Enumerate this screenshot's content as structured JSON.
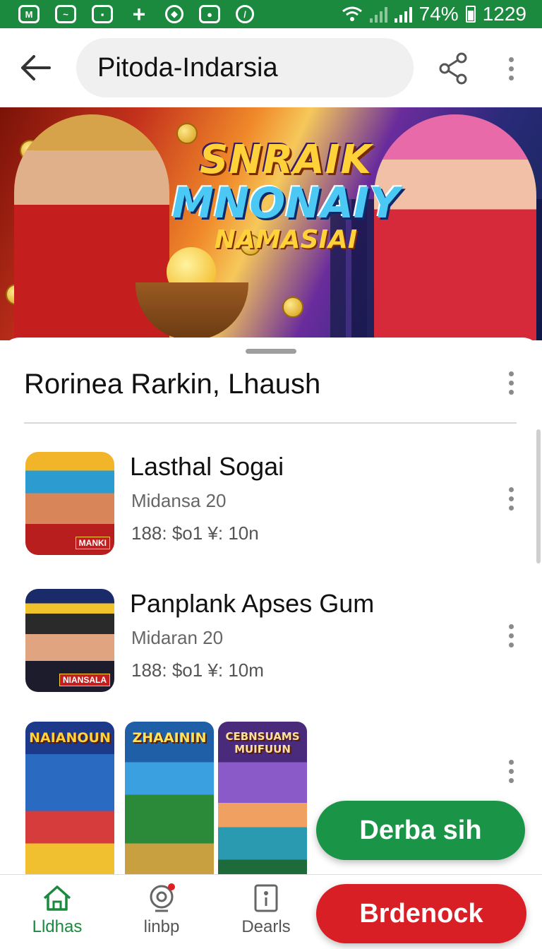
{
  "status_bar": {
    "battery": "74%",
    "time": "1229",
    "notification_icons": [
      "message-icon",
      "link-icon",
      "square-icon",
      "plus-icon",
      "shield-icon",
      "record-icon",
      "compass-icon"
    ]
  },
  "app_bar": {
    "title": "Pitoda-Indarsia"
  },
  "banner": {
    "line1": "SNRAIK",
    "line2": "MNONAIY",
    "line3": "NAMASIAI"
  },
  "section": {
    "title": "Rorinea Rarkin, Lhaush"
  },
  "apps": [
    {
      "name": "Lasthal Sogai",
      "subtitle": "Midansa 20",
      "meta": "188: $o1 ¥: 10n",
      "thumb_tag": "MANKI"
    },
    {
      "name": "Panplank Apses Gum",
      "subtitle": "Midaran 20",
      "meta": "188: $o1 ¥: 10m",
      "thumb_tag": "NIANSALA"
    }
  ],
  "screenshots": [
    {
      "label": "NAIANOUN"
    },
    {
      "label": "ZHAAININ"
    },
    {
      "label": "CEBNSUAMS MUIFUUN"
    }
  ],
  "fab_primary": {
    "label": "Derba sih"
  },
  "bottom_nav": {
    "items": [
      {
        "label": "Lldhas",
        "icon": "home-icon"
      },
      {
        "label": "linbp",
        "icon": "camera-icon"
      },
      {
        "label": "Dearls",
        "icon": "info-card-icon"
      }
    ],
    "action_label": "Brdenock"
  },
  "colors": {
    "brand_green": "#1b8a3f",
    "fab_green": "#1a9548",
    "action_red": "#d81f26"
  }
}
